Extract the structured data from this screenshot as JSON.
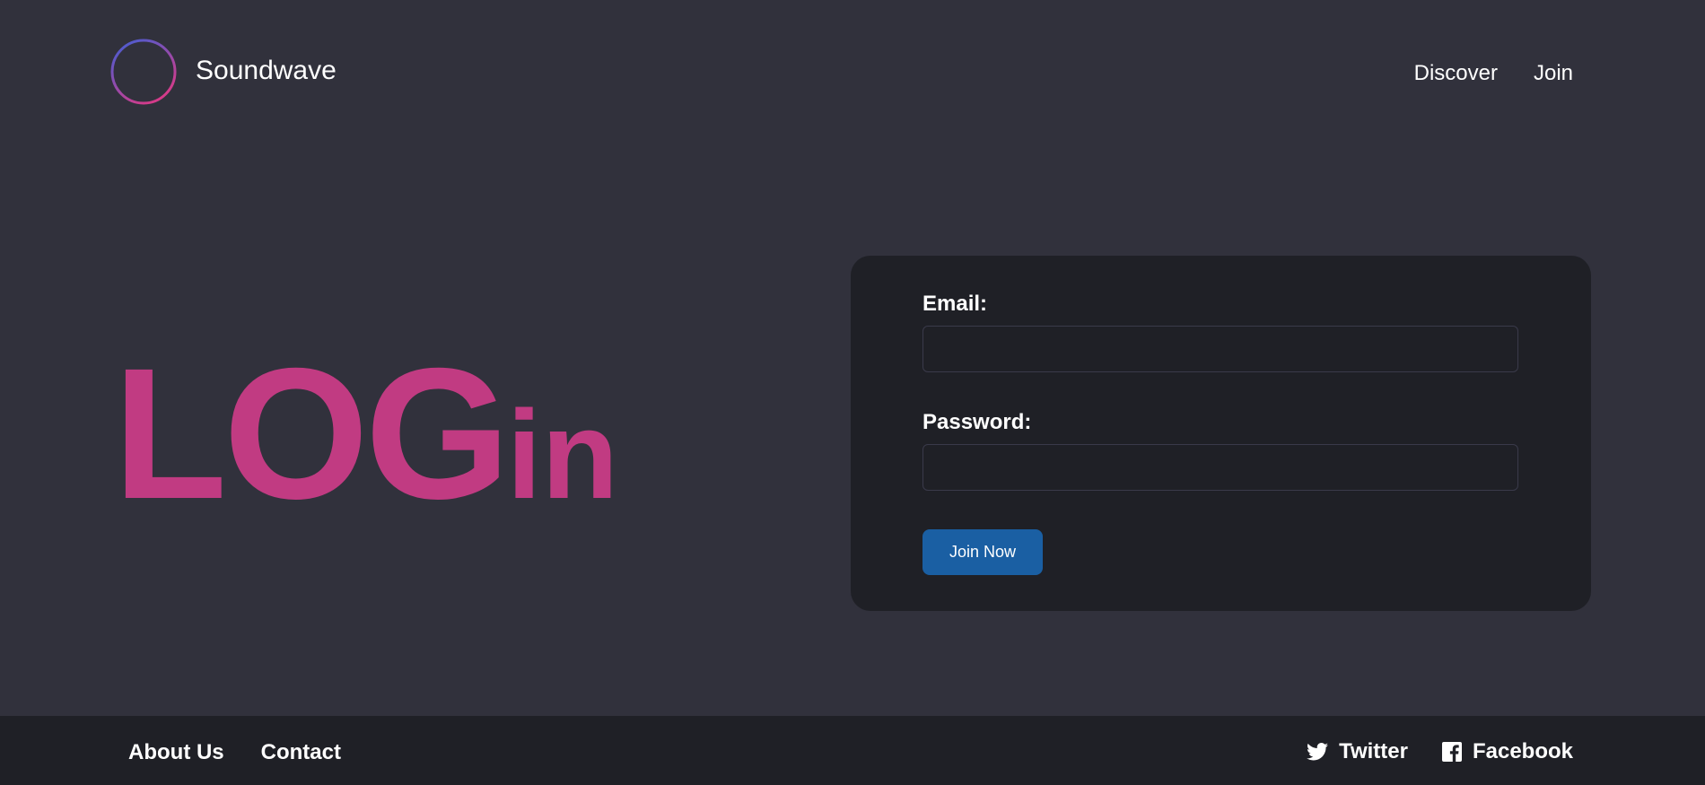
{
  "header": {
    "brand": "Soundwave",
    "nav": [
      {
        "label": "Discover"
      },
      {
        "label": "Join"
      }
    ]
  },
  "hero": {
    "title_big": "LOG",
    "title_small": "in"
  },
  "form": {
    "email_label": "Email:",
    "email_value": "",
    "password_label": "Password:",
    "password_value": "",
    "submit_label": "Join Now"
  },
  "footer": {
    "links": [
      {
        "label": "About Us"
      },
      {
        "label": "Contact"
      }
    ],
    "social": [
      {
        "label": "Twitter",
        "icon": "twitter-icon"
      },
      {
        "label": "Facebook",
        "icon": "facebook-icon"
      }
    ]
  },
  "colors": {
    "background": "#31313c",
    "card": "#1f2026",
    "accent": "#c13b82",
    "button": "#1a5fa3",
    "logo_gradient_start": "#3f5fd6",
    "logo_gradient_end": "#d43b8a"
  }
}
